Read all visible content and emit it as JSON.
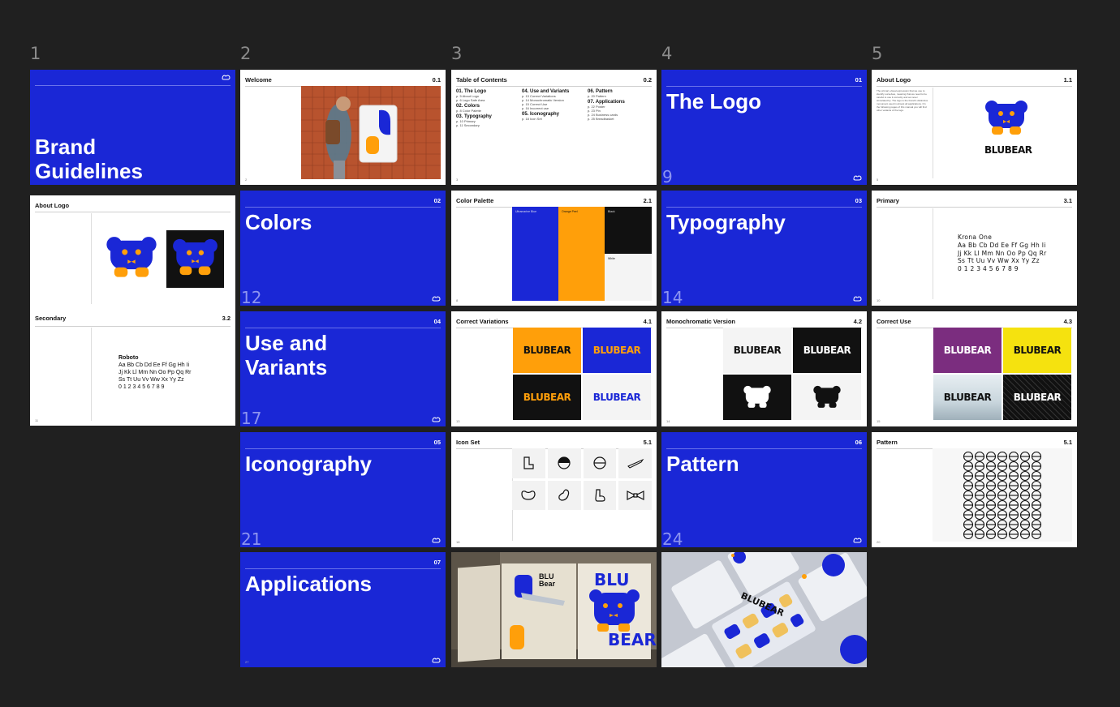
{
  "columns": [
    "1",
    "2",
    "3",
    "4",
    "5"
  ],
  "colors": {
    "blue": "#1a27d6",
    "orange": "#ff9f0a",
    "black": "#111111",
    "white": "#ffffff",
    "purple": "#7b2d7f",
    "yellow": "#f5e20f"
  },
  "slides": {
    "cover": {
      "title_line1": "Brand",
      "title_line2": "Guidelines"
    },
    "welcome": {
      "title": "Welcome",
      "num": "0.1",
      "page": "2"
    },
    "toc": {
      "title": "Table of Contents",
      "num": "0.2",
      "page": "3",
      "col1": [
        {
          "sec": "01. The Logo",
          "items": [
            "p. 5 About Logo",
            "p. 6 Logo Safe Area"
          ]
        },
        {
          "sec": "02. Colors",
          "items": [
            "p. 8 Color Palette"
          ]
        },
        {
          "sec": "03. Typography",
          "items": [
            "p. 10 Primary",
            "p. 11 Secondary"
          ]
        }
      ],
      "col2": [
        {
          "sec": "04. Use and Variants",
          "items": [
            "p. 13 Correct Variations",
            "p. 14 Monochromatic Version",
            "p. 15 Correct Use",
            "p. 16 Incorrect use"
          ]
        },
        {
          "sec": "05. Iconography",
          "items": [
            "p. 18 Icon Set"
          ]
        }
      ],
      "col3": [
        {
          "sec": "06. Pattern",
          "items": [
            "p. 20 Pattern"
          ]
        },
        {
          "sec": "07. Applications",
          "items": [
            "p. 22 Poster",
            "p. 23 Pin",
            "p. 24 Business cards",
            "p. 25 Breadbasket"
          ]
        }
      ]
    },
    "logo_divider": {
      "title": "The Logo",
      "num": "01",
      "page": "9"
    },
    "about_logo": {
      "title": "About Logo",
      "num": "1.1",
      "page": "5",
      "wordmark": "BLUBEAR",
      "body": "The primary visual expression that we use to identify ourselves, meaning that we need to be careful to use it correctly and as never stimulated by. The logo is the brand's distinctive monument used in almost all applications. On the following pages of this manual you will find other variants of the logo."
    },
    "about_logo2": {
      "title": "About Logo",
      "page": "6"
    },
    "colors_divider": {
      "title": "Colors",
      "num": "02",
      "page": "12"
    },
    "color_palette": {
      "title": "Color Palette",
      "num": "2.1",
      "page": "8",
      "swatches": [
        "Ultramarine Blue",
        "Orange Peel",
        "Black",
        "White"
      ]
    },
    "typo_divider": {
      "title": "Typography",
      "num": "03",
      "page": "14"
    },
    "primary": {
      "title": "Primary",
      "num": "3.1",
      "page": "10",
      "font": "Krona One",
      "l1": "Aa Bb Cb Dd Ee Ff Gg Hh Ii",
      "l2": "Jj Kk Ll Mm Nn Oo Pp Qq Rr",
      "l3": "Ss Tt Uu Vv Ww Xx Yy Zz",
      "l4": "0 1 2 3 4 5 6 7 8 9"
    },
    "secondary": {
      "title": "Secondary",
      "num": "3.2",
      "page": "11",
      "font": "Roboto",
      "l1": "Aa Bb Cb Dd Ee Ff Gg Hh Ii",
      "l2": "Jj Kk Ll Mm Nn Oo Pp Qq Rr",
      "l3": "Ss Tt Uu Vv Ww Xx Yy Zz",
      "l4": "0 1 2 3 4 5 6 7 8 9"
    },
    "use_divider": {
      "title_line1": "Use and",
      "title_line2": "Variants",
      "num": "04",
      "page": "17"
    },
    "correct_variations": {
      "title": "Correct Variations",
      "num": "4.1",
      "page": "13",
      "wordmark": "BLUBEAR"
    },
    "mono": {
      "title": "Monochromatic Version",
      "num": "4.2",
      "page": "14",
      "wordmark": "BLUBEAR"
    },
    "correct_use": {
      "title": "Correct Use",
      "num": "4.3",
      "page": "15",
      "wordmark": "BLUBEAR"
    },
    "icon_divider": {
      "title": "Iconography",
      "num": "05",
      "page": "21"
    },
    "icon_set": {
      "title": "Icon Set",
      "num": "5.1",
      "page": "18"
    },
    "pattern_divider": {
      "title": "Pattern",
      "num": "06",
      "page": "24"
    },
    "pattern": {
      "title": "Pattern",
      "num": "5.1",
      "page": "20"
    },
    "apps_divider": {
      "title": "Applications",
      "num": "07",
      "page": "27"
    },
    "poster": {
      "blu": "BLU",
      "bear": "BEAR",
      "small_blu": "BLU",
      "small_bear": "Bear"
    },
    "mockup": {
      "wordmark": "BLUBEAR"
    }
  }
}
